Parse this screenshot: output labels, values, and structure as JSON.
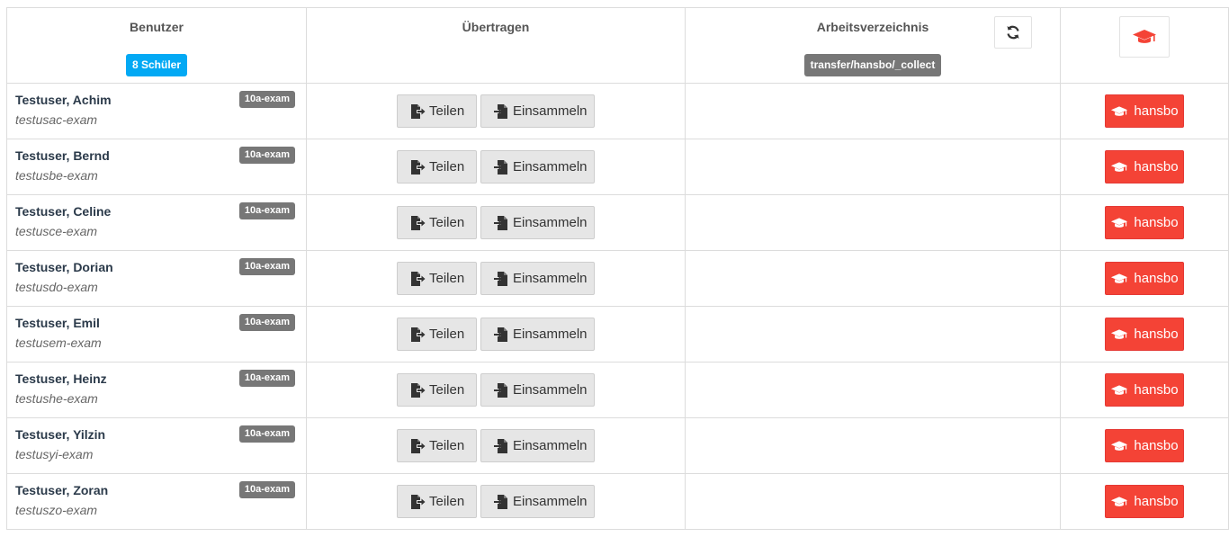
{
  "header": {
    "user_col": "Benutzer",
    "student_count_badge": "8 Schüler",
    "transfer_col": "Übertragen",
    "workdir_col": "Arbeitsverzeichnis",
    "workdir_path_badge": "transfer/hansbo/_collect"
  },
  "actions": {
    "share_label": "Teilen",
    "collect_label": "Einsammeln",
    "exam_label": "hansbo"
  },
  "colors": {
    "accent_blue": "#03a9f4",
    "exam_red": "#f44336",
    "badge_grey": "#777777"
  },
  "icons": {
    "refresh": "refresh-icon",
    "exam_header": "graduation-cap-icon",
    "share": "file-export-icon",
    "collect": "file-import-icon",
    "exam_button": "graduation-cap-icon"
  },
  "rows": [
    {
      "name": "Testuser, Achim",
      "login": "testusac-exam",
      "group": "10a-exam"
    },
    {
      "name": "Testuser, Bernd",
      "login": "testusbe-exam",
      "group": "10a-exam"
    },
    {
      "name": "Testuser, Celine",
      "login": "testusce-exam",
      "group": "10a-exam"
    },
    {
      "name": "Testuser, Dorian",
      "login": "testusdo-exam",
      "group": "10a-exam"
    },
    {
      "name": "Testuser, Emil",
      "login": "testusem-exam",
      "group": "10a-exam"
    },
    {
      "name": "Testuser, Heinz",
      "login": "testushe-exam",
      "group": "10a-exam"
    },
    {
      "name": "Testuser, Yilzin",
      "login": "testusyi-exam",
      "group": "10a-exam"
    },
    {
      "name": "Testuser, Zoran",
      "login": "testuszo-exam",
      "group": "10a-exam"
    }
  ]
}
